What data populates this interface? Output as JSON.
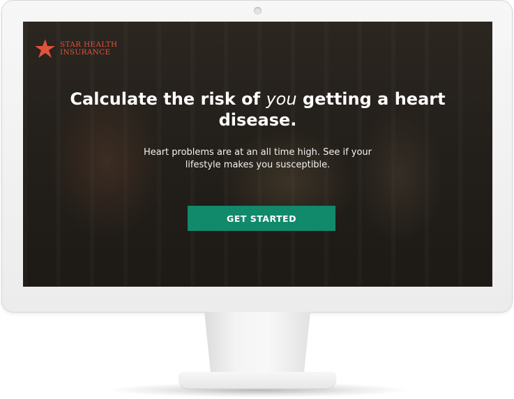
{
  "brand": {
    "name_line1": "STAR HEALTH",
    "name_line2": "INSURANCE",
    "icon": "star-icon",
    "color": "#e0533b"
  },
  "hero": {
    "headline_before": "Calculate the risk of ",
    "headline_emphasis": "you",
    "headline_after": " getting a heart disease.",
    "subtext": "Heart problems are at an all time high. See if your lifestyle makes you susceptible.",
    "cta_label": "GET STARTED",
    "cta_color": "#118a6c"
  }
}
